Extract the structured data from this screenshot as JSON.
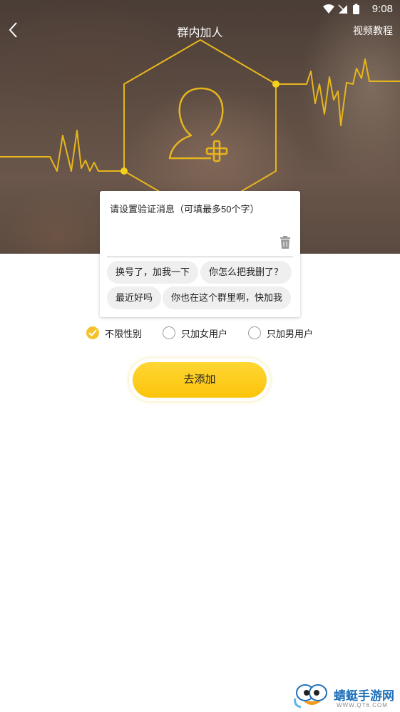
{
  "status": {
    "time": "9:08"
  },
  "header": {
    "title": "群内加人",
    "tutorial": "视频教程"
  },
  "message": {
    "label": "请设置验证消息（可填最多50个字）",
    "value": "",
    "chips": [
      "换号了，加我一下",
      "你怎么把我删了？",
      "最近好吗",
      "你也在这个群里啊，快加我"
    ]
  },
  "gender": {
    "options": [
      "不限性别",
      "只加女用户",
      "只加男用户"
    ],
    "selected": "不限性别"
  },
  "action": {
    "label": "去添加"
  },
  "watermark": {
    "name": "蜻蜓手游网",
    "url": "WWW.QT6.COM"
  },
  "colors": {
    "accent": "#f4c22b",
    "line": "#e7b51c"
  }
}
